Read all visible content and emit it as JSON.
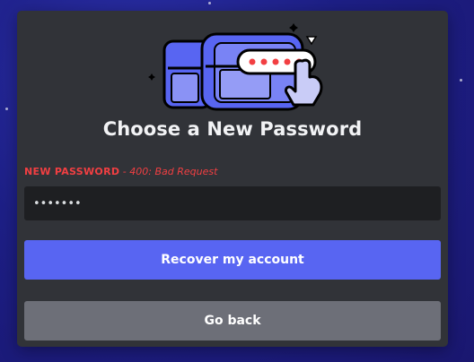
{
  "modal": {
    "title": "Choose a New Password",
    "illustration_icon": "treasure-chest-password-icon"
  },
  "password_field": {
    "label": "NEW PASSWORD",
    "error_separator": " - ",
    "error": "400: Bad Request",
    "value": "•••••••",
    "input_type": "password"
  },
  "buttons": {
    "recover_label": "Recover my account",
    "back_label": "Go back"
  },
  "colors": {
    "accent": "#5865f2",
    "error": "#f23f42",
    "modal_bg": "#313338",
    "input_bg": "#1e1f22",
    "secondary_button": "#6d6f78"
  }
}
